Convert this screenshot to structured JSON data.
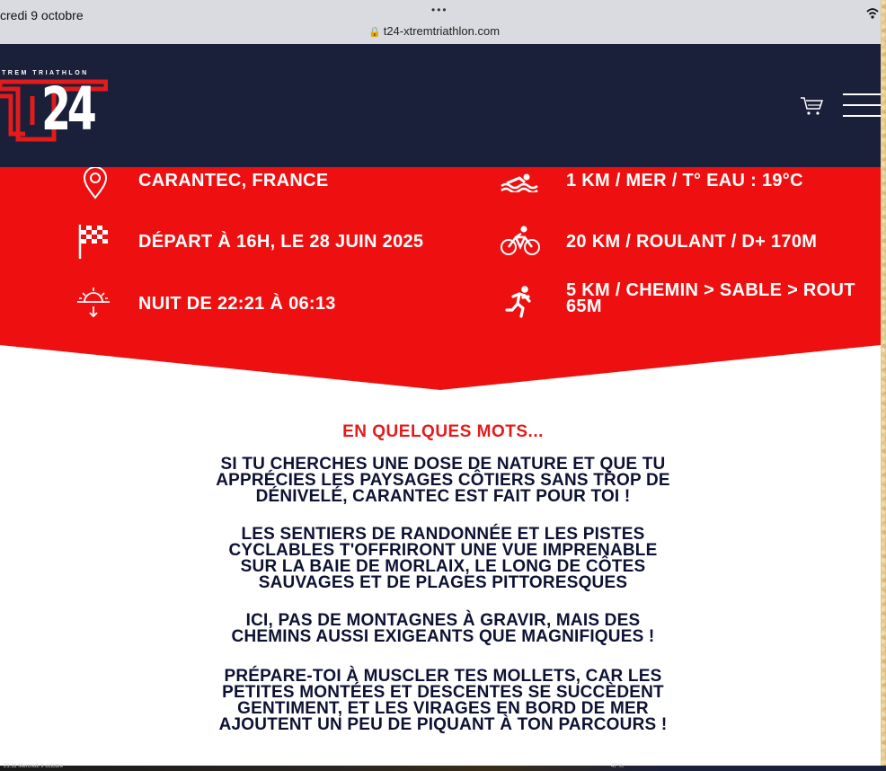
{
  "status_bar": {
    "date": "credi 9 octobre",
    "dots": "•••",
    "url": "t24-xtremtriathlon.com"
  },
  "header": {
    "brand_text": "TREM TRIATHLON",
    "logo_number": "24"
  },
  "info": {
    "location": "CARANTEC, FRANCE",
    "swim": "1 KM / MER / T° EAU : 19°C",
    "start": "DÉPART À 16H, LE 28 JUIN 2025",
    "bike": "20 KM / ROULANT / D+ 170M",
    "night": "NUIT DE 22:21 À 06:13",
    "run_line1": "5 KM / CHEMIN > SABLE > ROUT",
    "run_line2": "65M"
  },
  "content": {
    "title": "EN QUELQUES MOTS...",
    "p1": [
      "SI TU CHERCHES UNE DOSE DE NATURE ET QUE TU",
      "APPRÉCIES LES PAYSAGES CÔTIERS SANS TROP DE",
      "DÉNIVELÉ, CARANTEC EST FAIT POUR TOI !"
    ],
    "p2": [
      "LES SENTIERS DE RANDONNÉE ET LES PISTES",
      "CYCLABLES T'OFFRIRONT UNE VUE IMPRENABLE",
      "SUR LA BAIE DE MORLAIX, LE LONG DE CÔTES",
      "SAUVAGES ET DE PLAGES PITTORESQUES"
    ],
    "p3": [
      "ICI, PAS DE MONTAGNES À GRAVIR, MAIS DES",
      "CHEMINS AUSSI EXIGEANTS QUE MAGNIFIQUES !"
    ],
    "p4": [
      "PRÉPARE-TOI À MUSCLER TES MOLLETS, CAR LES",
      "PETITES MONTÉES ET DESCENTES SE SUCCÈDENT",
      "GENTIMENT, ET LES VIRAGES EN BORD DE MER",
      "AJOUTENT UN PEU DE PIQUANT À TON PARCOURS !"
    ]
  },
  "bottom": {
    "left": "21:11 Mercredi 9 octobre",
    "right": "47 %"
  },
  "colors": {
    "navy": "#1a1f3a",
    "red": "#ee1010",
    "title_red": "#e31b1b",
    "text_navy": "#0d1233"
  },
  "icons": [
    "lock-icon",
    "wifi-icon",
    "cart-icon",
    "menu-icon",
    "location-pin-icon",
    "swim-icon",
    "checkered-flag-icon",
    "bike-icon",
    "sunset-icon",
    "runner-icon"
  ]
}
